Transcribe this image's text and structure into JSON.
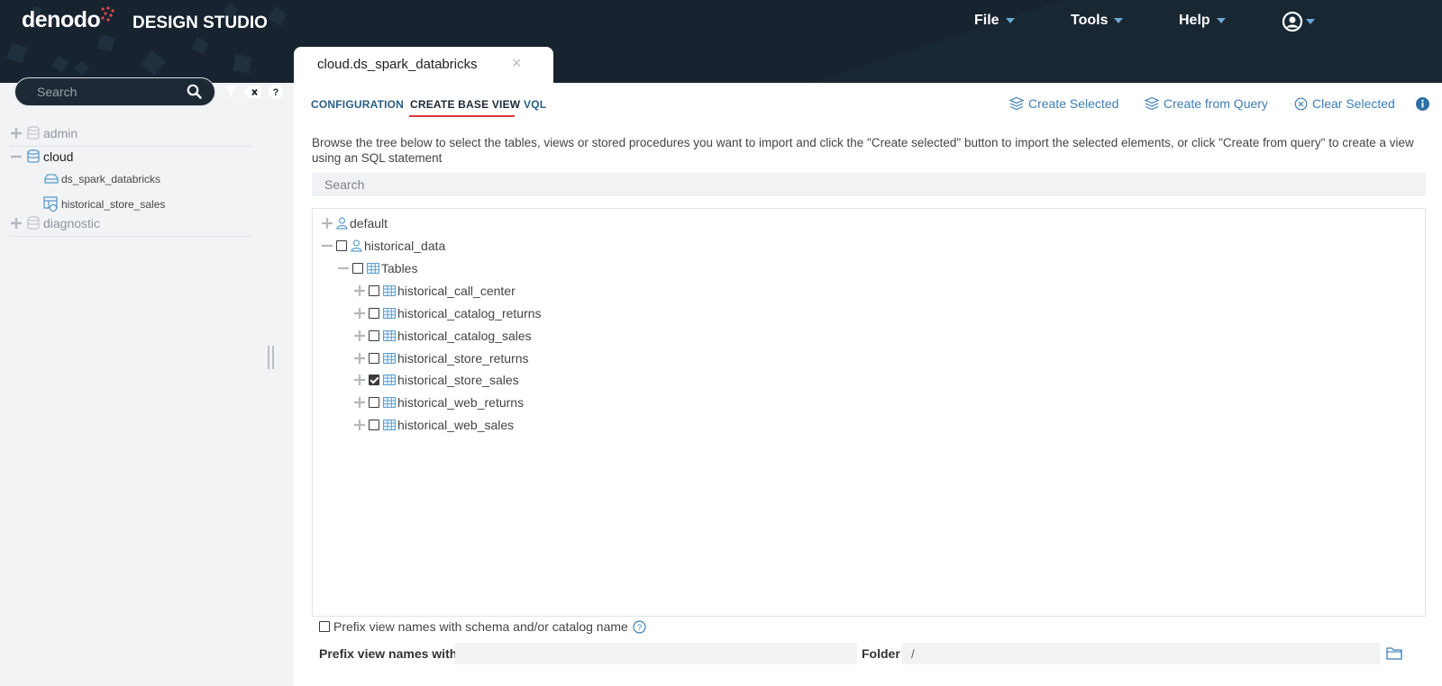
{
  "header": {
    "logo_text": "denodo",
    "app_title": "DESIGN STUDIO",
    "menus": [
      {
        "label": "File"
      },
      {
        "label": "Tools"
      },
      {
        "label": "Help"
      }
    ],
    "user_icon": "user-circle-icon"
  },
  "sidebar": {
    "search_placeholder": "Search",
    "tree": [
      {
        "label": "admin",
        "state": "collapsed",
        "icon": "database-icon"
      },
      {
        "label": "cloud",
        "state": "expanded",
        "icon": "database-icon"
      },
      {
        "label": "ds_spark_databricks",
        "icon": "datasource-icon"
      },
      {
        "label": "historical_store_sales",
        "icon": "base-view-icon"
      },
      {
        "label": "diagnostic",
        "state": "collapsed",
        "icon": "database-icon"
      }
    ]
  },
  "tab": {
    "label": "cloud.ds_spark_databricks",
    "close": "×"
  },
  "subtabs": [
    {
      "label": "CONFIGURATION"
    },
    {
      "label": "CREATE BASE VIEW"
    },
    {
      "label": "VQL"
    }
  ],
  "actions": {
    "create_selected": "Create Selected",
    "create_from_query": "Create from Query",
    "clear_selected": "Clear Selected"
  },
  "description": "Browse the tree below to select the tables, views or stored procedures you want to import and click the \"Create selected\" button to import the selected elements, or click \"Create from query\" to create a view using an SQL statement",
  "tree_search_placeholder": "Search",
  "tree": {
    "default": "default",
    "historical_data": "historical_data",
    "tables": "Tables",
    "items": [
      {
        "label": "historical_call_center",
        "checked": false
      },
      {
        "label": "historical_catalog_returns",
        "checked": false
      },
      {
        "label": "historical_catalog_sales",
        "checked": false
      },
      {
        "label": "historical_store_returns",
        "checked": false
      },
      {
        "label": "historical_store_sales",
        "checked": true
      },
      {
        "label": "historical_web_returns",
        "checked": false
      },
      {
        "label": "historical_web_sales",
        "checked": false
      }
    ]
  },
  "options": {
    "prefix_checkbox_label": "Prefix view names with schema and/or catalog name",
    "prefix_label": "Prefix view names with",
    "prefix_value": "",
    "folder_label": "Folder",
    "folder_value": "/"
  },
  "colors": {
    "header_bg": "#17242f",
    "accent_blue": "#3d7eb2",
    "active_underline": "#d63a3a",
    "logo_dots": "#e5484d"
  }
}
